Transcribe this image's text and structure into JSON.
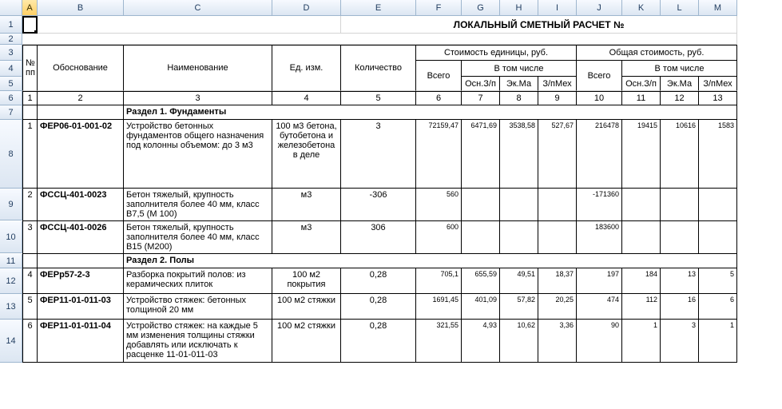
{
  "columns": [
    "A",
    "B",
    "C",
    "D",
    "E",
    "F",
    "G",
    "H",
    "I",
    "J",
    "K",
    "L",
    "M"
  ],
  "row_numbers": [
    "1",
    "2",
    "3",
    "4",
    "5",
    "6",
    "7",
    "8",
    "9",
    "10",
    "11",
    "12",
    "13",
    "14"
  ],
  "title": "ЛОКАЛЬНЫЙ СМЕТНЫЙ РАСЧЕТ №",
  "headers": {
    "npp": "№ пп",
    "osn": "Обоснование",
    "name": "Наименование",
    "unit": "Ед. изм.",
    "qty": "Количество",
    "unit_cost": "Стоимость единицы, руб.",
    "total_cost": "Общая стоимость, руб.",
    "vsego": "Всего",
    "vtom": "В том числе",
    "osnzp": "Осн.З/п",
    "ekma": "Эк.Ма",
    "zpmex": "З/пМех"
  },
  "colnums": {
    "c1": "1",
    "c2": "2",
    "c3": "3",
    "c4": "4",
    "c5": "5",
    "c6": "6",
    "c7": "7",
    "c8": "8",
    "c9": "9",
    "c10": "10",
    "c11": "11",
    "c12": "12",
    "c13": "13"
  },
  "sections": {
    "s1": "Раздел 1. Фундаменты",
    "s2": "Раздел 2. Полы"
  },
  "rows": [
    {
      "n": "1",
      "osn": "ФЕР06-01-001-02",
      "name": "Устройство бетонных фундаментов общего назначения под колонны объемом: до 3 м3",
      "unit": "100 м3 бетона, бутобетона и железобетона в деле",
      "qty": "3",
      "c6": "72159,47",
      "c7": "6471,69",
      "c8": "3538,58",
      "c9": "527,67",
      "c10": "216478",
      "c11": "19415",
      "c12": "10616",
      "c13": "1583"
    },
    {
      "n": "2",
      "osn": "ФССЦ-401-0023",
      "name": "Бетон тяжелый, крупность заполнителя более 40 мм, класс В7,5 (М 100)",
      "unit": "м3",
      "qty": "-306",
      "c6": "560",
      "c7": "",
      "c8": "",
      "c9": "",
      "c10": "-171360",
      "c11": "",
      "c12": "",
      "c13": ""
    },
    {
      "n": "3",
      "osn": "ФССЦ-401-0026",
      "name": "Бетон тяжелый, крупность заполнителя более 40 мм, класс В15 (М200)",
      "unit": "м3",
      "qty": "306",
      "c6": "600",
      "c7": "",
      "c8": "",
      "c9": "",
      "c10": "183600",
      "c11": "",
      "c12": "",
      "c13": ""
    },
    {
      "n": "4",
      "osn": "ФЕРр57-2-3",
      "name": "Разборка покрытий полов: из керамических плиток",
      "unit": "100 м2 покрытия",
      "qty": "0,28",
      "c6": "705,1",
      "c7": "655,59",
      "c8": "49,51",
      "c9": "18,37",
      "c10": "197",
      "c11": "184",
      "c12": "13",
      "c13": "5"
    },
    {
      "n": "5",
      "osn": "ФЕР11-01-011-03",
      "name": "Устройство стяжек: бетонных толщиной 20 мм",
      "unit": "100 м2 стяжки",
      "qty": "0,28",
      "c6": "1691,45",
      "c7": "401,09",
      "c8": "57,82",
      "c9": "20,25",
      "c10": "474",
      "c11": "112",
      "c12": "16",
      "c13": "6"
    },
    {
      "n": "6",
      "osn": "ФЕР11-01-011-04",
      "name": "Устройство стяжек: на каждые 5 мм изменения толщины стяжки добавлять или исключать к расценке 11-01-011-03",
      "unit": "100 м2 стяжки",
      "qty": "0,28",
      "c6": "321,55",
      "c7": "4,93",
      "c8": "10,62",
      "c9": "3,36",
      "c10": "90",
      "c11": "1",
      "c12": "3",
      "c13": "1"
    }
  ],
  "chart_data": {
    "type": "table",
    "title": "ЛОКАЛЬНЫЙ СМЕТНЫЙ РАСЧЕТ №",
    "columns": [
      "№ пп",
      "Обоснование",
      "Наименование",
      "Ед. изм.",
      "Количество",
      "Стоимость ед. Всего",
      "Осн.З/п",
      "Эк.Ма",
      "З/пМех",
      "Общая Всего",
      "Осн.З/п",
      "Эк.Ма",
      "З/пМех"
    ],
    "sections": [
      {
        "name": "Раздел 1. Фундаменты",
        "rows": [
          [
            1,
            "ФЕР06-01-001-02",
            "Устройство бетонных фундаментов общего назначения под колонны объемом: до 3 м3",
            "100 м3 бетона, бутобетона и железобетона в деле",
            3,
            72159.47,
            6471.69,
            3538.58,
            527.67,
            216478,
            19415,
            10616,
            1583
          ],
          [
            2,
            "ФССЦ-401-0023",
            "Бетон тяжелый, крупность заполнителя более 40 мм, класс В7,5 (М 100)",
            "м3",
            -306,
            560,
            null,
            null,
            null,
            -171360,
            null,
            null,
            null
          ],
          [
            3,
            "ФССЦ-401-0026",
            "Бетон тяжелый, крупность заполнителя более 40 мм, класс В15 (М200)",
            "м3",
            306,
            600,
            null,
            null,
            null,
            183600,
            null,
            null,
            null
          ]
        ]
      },
      {
        "name": "Раздел 2. Полы",
        "rows": [
          [
            4,
            "ФЕРр57-2-3",
            "Разборка покрытий полов: из керамических плиток",
            "100 м2 покрытия",
            0.28,
            705.1,
            655.59,
            49.51,
            18.37,
            197,
            184,
            13,
            5
          ],
          [
            5,
            "ФЕР11-01-011-03",
            "Устройство стяжек: бетонных толщиной 20 мм",
            "100 м2 стяжки",
            0.28,
            1691.45,
            401.09,
            57.82,
            20.25,
            474,
            112,
            16,
            6
          ],
          [
            6,
            "ФЕР11-01-011-04",
            "Устройство стяжек: на каждые 5 мм изменения толщины стяжки добавлять или исключать к расценке 11-01-011-03",
            "100 м2 стяжки",
            0.28,
            321.55,
            4.93,
            10.62,
            3.36,
            90,
            1,
            3,
            1
          ]
        ]
      }
    ]
  }
}
